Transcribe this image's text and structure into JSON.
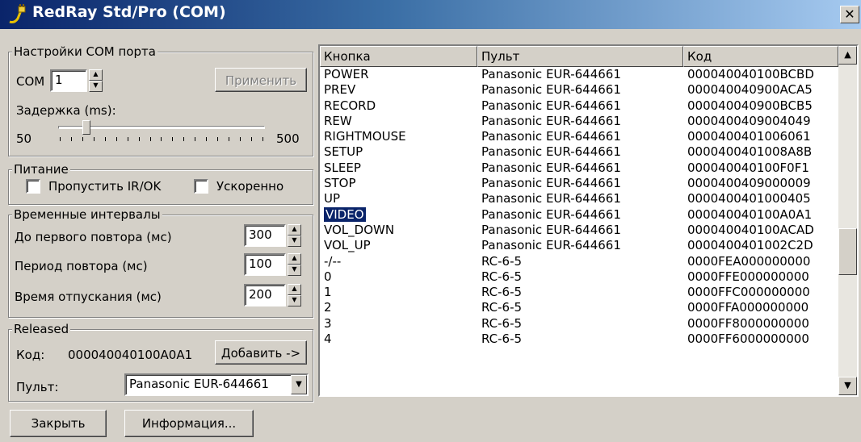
{
  "window": {
    "title": "RedRay Std/Pro (COM)",
    "close_icon": "close-icon",
    "title_gradient": [
      "#0a246a",
      "#a6caf0"
    ]
  },
  "com_settings": {
    "legend": "Настройки COM порта",
    "com_label": "COM",
    "com_value": "1",
    "apply_label": "Применить",
    "delay_label": "Задержка (ms):",
    "delay_min": "50",
    "delay_max": "500",
    "delay_level": 0.12
  },
  "power": {
    "legend": "Питание",
    "skip_ir_label": "Пропустить IR/OK",
    "skip_ir_checked": false,
    "accelerated_label": "Ускоренно",
    "accelerated_checked": false
  },
  "intervals": {
    "legend": "Временные интервалы",
    "first_repeat_label": "До первого повтора (мс)",
    "first_repeat_value": "300",
    "repeat_period_label": "Период повтора (мс)",
    "repeat_period_value": "100",
    "release_time_label": "Время отпускания (мс)",
    "release_time_value": "200"
  },
  "released": {
    "legend": "Released",
    "code_label": "Код:",
    "code_value": "000040040100A0A1",
    "add_label": "Добавить ->",
    "remote_label": "Пульт:",
    "remote_value": "Panasonic EUR-644661"
  },
  "buttons": {
    "close_label": "Закрыть",
    "info_label": "Информация..."
  },
  "table": {
    "columns": [
      "Кнопка",
      "Пульт",
      "Код"
    ],
    "selected_index": 9,
    "rows": [
      [
        "POWER",
        "Panasonic EUR-644661",
        "000040040100BCBD"
      ],
      [
        "PREV",
        "Panasonic EUR-644661",
        "000040040900ACA5"
      ],
      [
        "RECORD",
        "Panasonic EUR-644661",
        "000040040900BCB5"
      ],
      [
        "REW",
        "Panasonic EUR-644661",
        "0000400409004049"
      ],
      [
        "RIGHTMOUSE",
        "Panasonic EUR-644661",
        "0000400401006061"
      ],
      [
        "SETUP",
        "Panasonic EUR-644661",
        "0000400401008A8B"
      ],
      [
        "SLEEP",
        "Panasonic EUR-644661",
        "000040040100F0F1"
      ],
      [
        "STOP",
        "Panasonic EUR-644661",
        "0000400409000009"
      ],
      [
        "UP",
        "Panasonic EUR-644661",
        "0000400401000405"
      ],
      [
        "VIDEO",
        "Panasonic EUR-644661",
        "000040040100A0A1"
      ],
      [
        "VOL_DOWN",
        "Panasonic EUR-644661",
        "000040040100ACAD"
      ],
      [
        "VOL_UP",
        "Panasonic EUR-644661",
        "0000400401002C2D"
      ],
      [
        "-/--",
        "RC-6-5",
        "0000FEA000000000"
      ],
      [
        "0",
        "RC-6-5",
        "0000FFE000000000"
      ],
      [
        "1",
        "RC-6-5",
        "0000FFC000000000"
      ],
      [
        "2",
        "RC-6-5",
        "0000FFA000000000"
      ],
      [
        "3",
        "RC-6-5",
        "0000FF8000000000"
      ],
      [
        "4",
        "RC-6-5",
        "0000FF6000000000"
      ]
    ],
    "scroll_position": 0.52
  }
}
